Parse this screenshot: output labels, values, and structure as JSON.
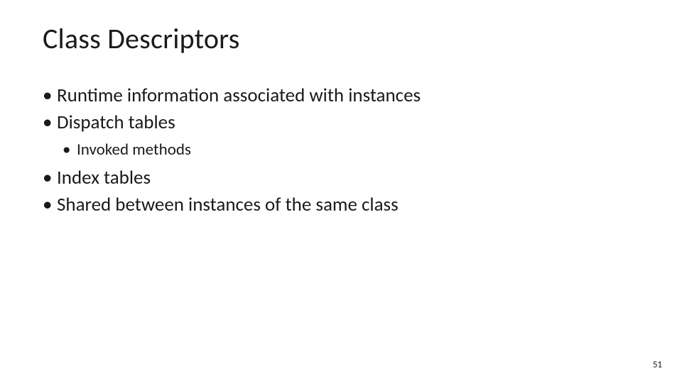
{
  "title": "Class Descriptors",
  "bullets": {
    "b1": "Runtime information associated with instances",
    "b2": "Dispatch tables",
    "b2_sub1": "Invoked methods",
    "b3": "Index tables",
    "b4": "Shared between instances of the same class"
  },
  "page_number": "51"
}
